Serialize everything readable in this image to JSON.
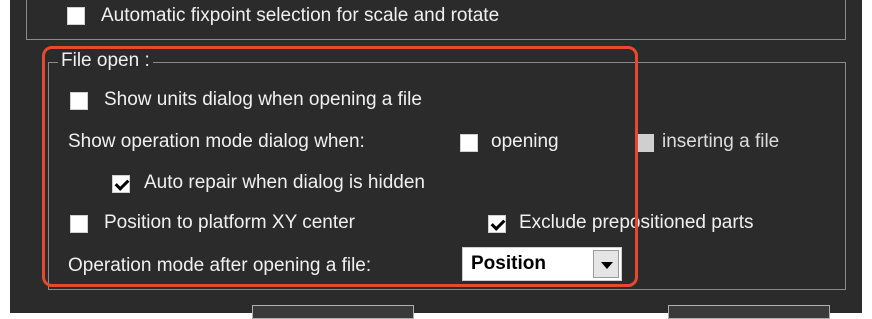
{
  "options": {
    "auto_fixpoint": {
      "label": "Automatic fixpoint selection for scale and rotate",
      "checked": false
    }
  },
  "file_open": {
    "group_label": "File open :",
    "show_units_dialog": {
      "label": "Show units dialog when opening a file",
      "checked": false
    },
    "operation_mode_dialog_label": "Show operation mode dialog when:",
    "opening": {
      "label": "opening",
      "checked": false
    },
    "inserting": {
      "label": "inserting a file",
      "checked": false
    },
    "auto_repair": {
      "label": "Auto repair when dialog is hidden",
      "checked": true
    },
    "position_center": {
      "label": "Position to platform XY center",
      "checked": false
    },
    "exclude_prepositioned": {
      "label": "Exclude prepositioned parts",
      "checked": true
    },
    "operation_mode_after_label": "Operation mode after opening a file:",
    "operation_mode_value": "Position"
  },
  "colors": {
    "highlight": "#e64a2e",
    "background": "#2b2b2b"
  }
}
